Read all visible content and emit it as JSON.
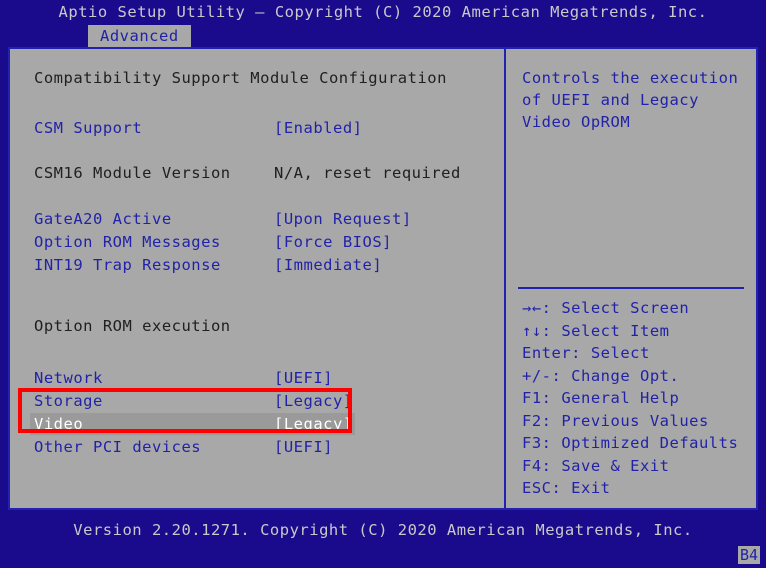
{
  "titlebar": {
    "text": "Aptio Setup Utility – Copyright (C) 2020 American Megatrends, Inc."
  },
  "tabs": [
    {
      "label": "Advanced",
      "selected": true
    }
  ],
  "settings_pane": {
    "section_title": "Compatibility Support Module Configuration",
    "group_title": "Option ROM execution",
    "rows": [
      {
        "label": "CSM Support",
        "value": "[Enabled]",
        "state": "normal"
      },
      {
        "label": "CSM16 Module Version",
        "value": "N/A, reset required",
        "state": "dim"
      },
      {
        "label": "GateA20 Active",
        "value": "[Upon Request]",
        "state": "normal"
      },
      {
        "label": "Option ROM Messages",
        "value": "[Force BIOS]",
        "state": "normal"
      },
      {
        "label": "INT19 Trap Response",
        "value": "[Immediate]",
        "state": "normal"
      },
      {
        "label": "Network",
        "value": "[UEFI]",
        "state": "normal"
      },
      {
        "label": "Storage",
        "value": "[Legacy]",
        "state": "normal"
      },
      {
        "label": "Video",
        "value": "[Legacy]",
        "state": "active"
      },
      {
        "label": "Other PCI devices",
        "value": "[UEFI]",
        "state": "normal"
      }
    ]
  },
  "help_pane": {
    "description": "Controls the execution of UEFI and Legacy Video OpROM",
    "keys": [
      {
        "key": "→←:",
        "action": " Select Screen"
      },
      {
        "key": "↑↓:",
        "action": " Select Item"
      },
      {
        "key": "Enter:",
        "action": " Select"
      },
      {
        "key": "+/-:",
        "action": " Change Opt."
      },
      {
        "key": "F1:",
        "action": " General Help"
      },
      {
        "key": "F2:",
        "action": " Previous Values"
      },
      {
        "key": "F3:",
        "action": " Optimized Defaults"
      },
      {
        "key": "F4:",
        "action": " Save & Exit"
      },
      {
        "key": "ESC:",
        "action": " Exit"
      }
    ]
  },
  "footer": {
    "text": "Version 2.20.1271. Copyright (C) 2020 American Megatrends, Inc.",
    "corner_badge": "B4"
  },
  "annotation": {
    "highlight_color": "#fe0000",
    "highlighted_rows": [
      "Storage",
      "Video"
    ]
  },
  "colors": {
    "background": "#1a0a8c",
    "panel": "#a8a8a8",
    "text_blue": "#2222a8",
    "text_dim": "#202020",
    "text_selected": "#ffffff",
    "selection_bar": "#9a9a9a",
    "border": "#2222b0"
  }
}
